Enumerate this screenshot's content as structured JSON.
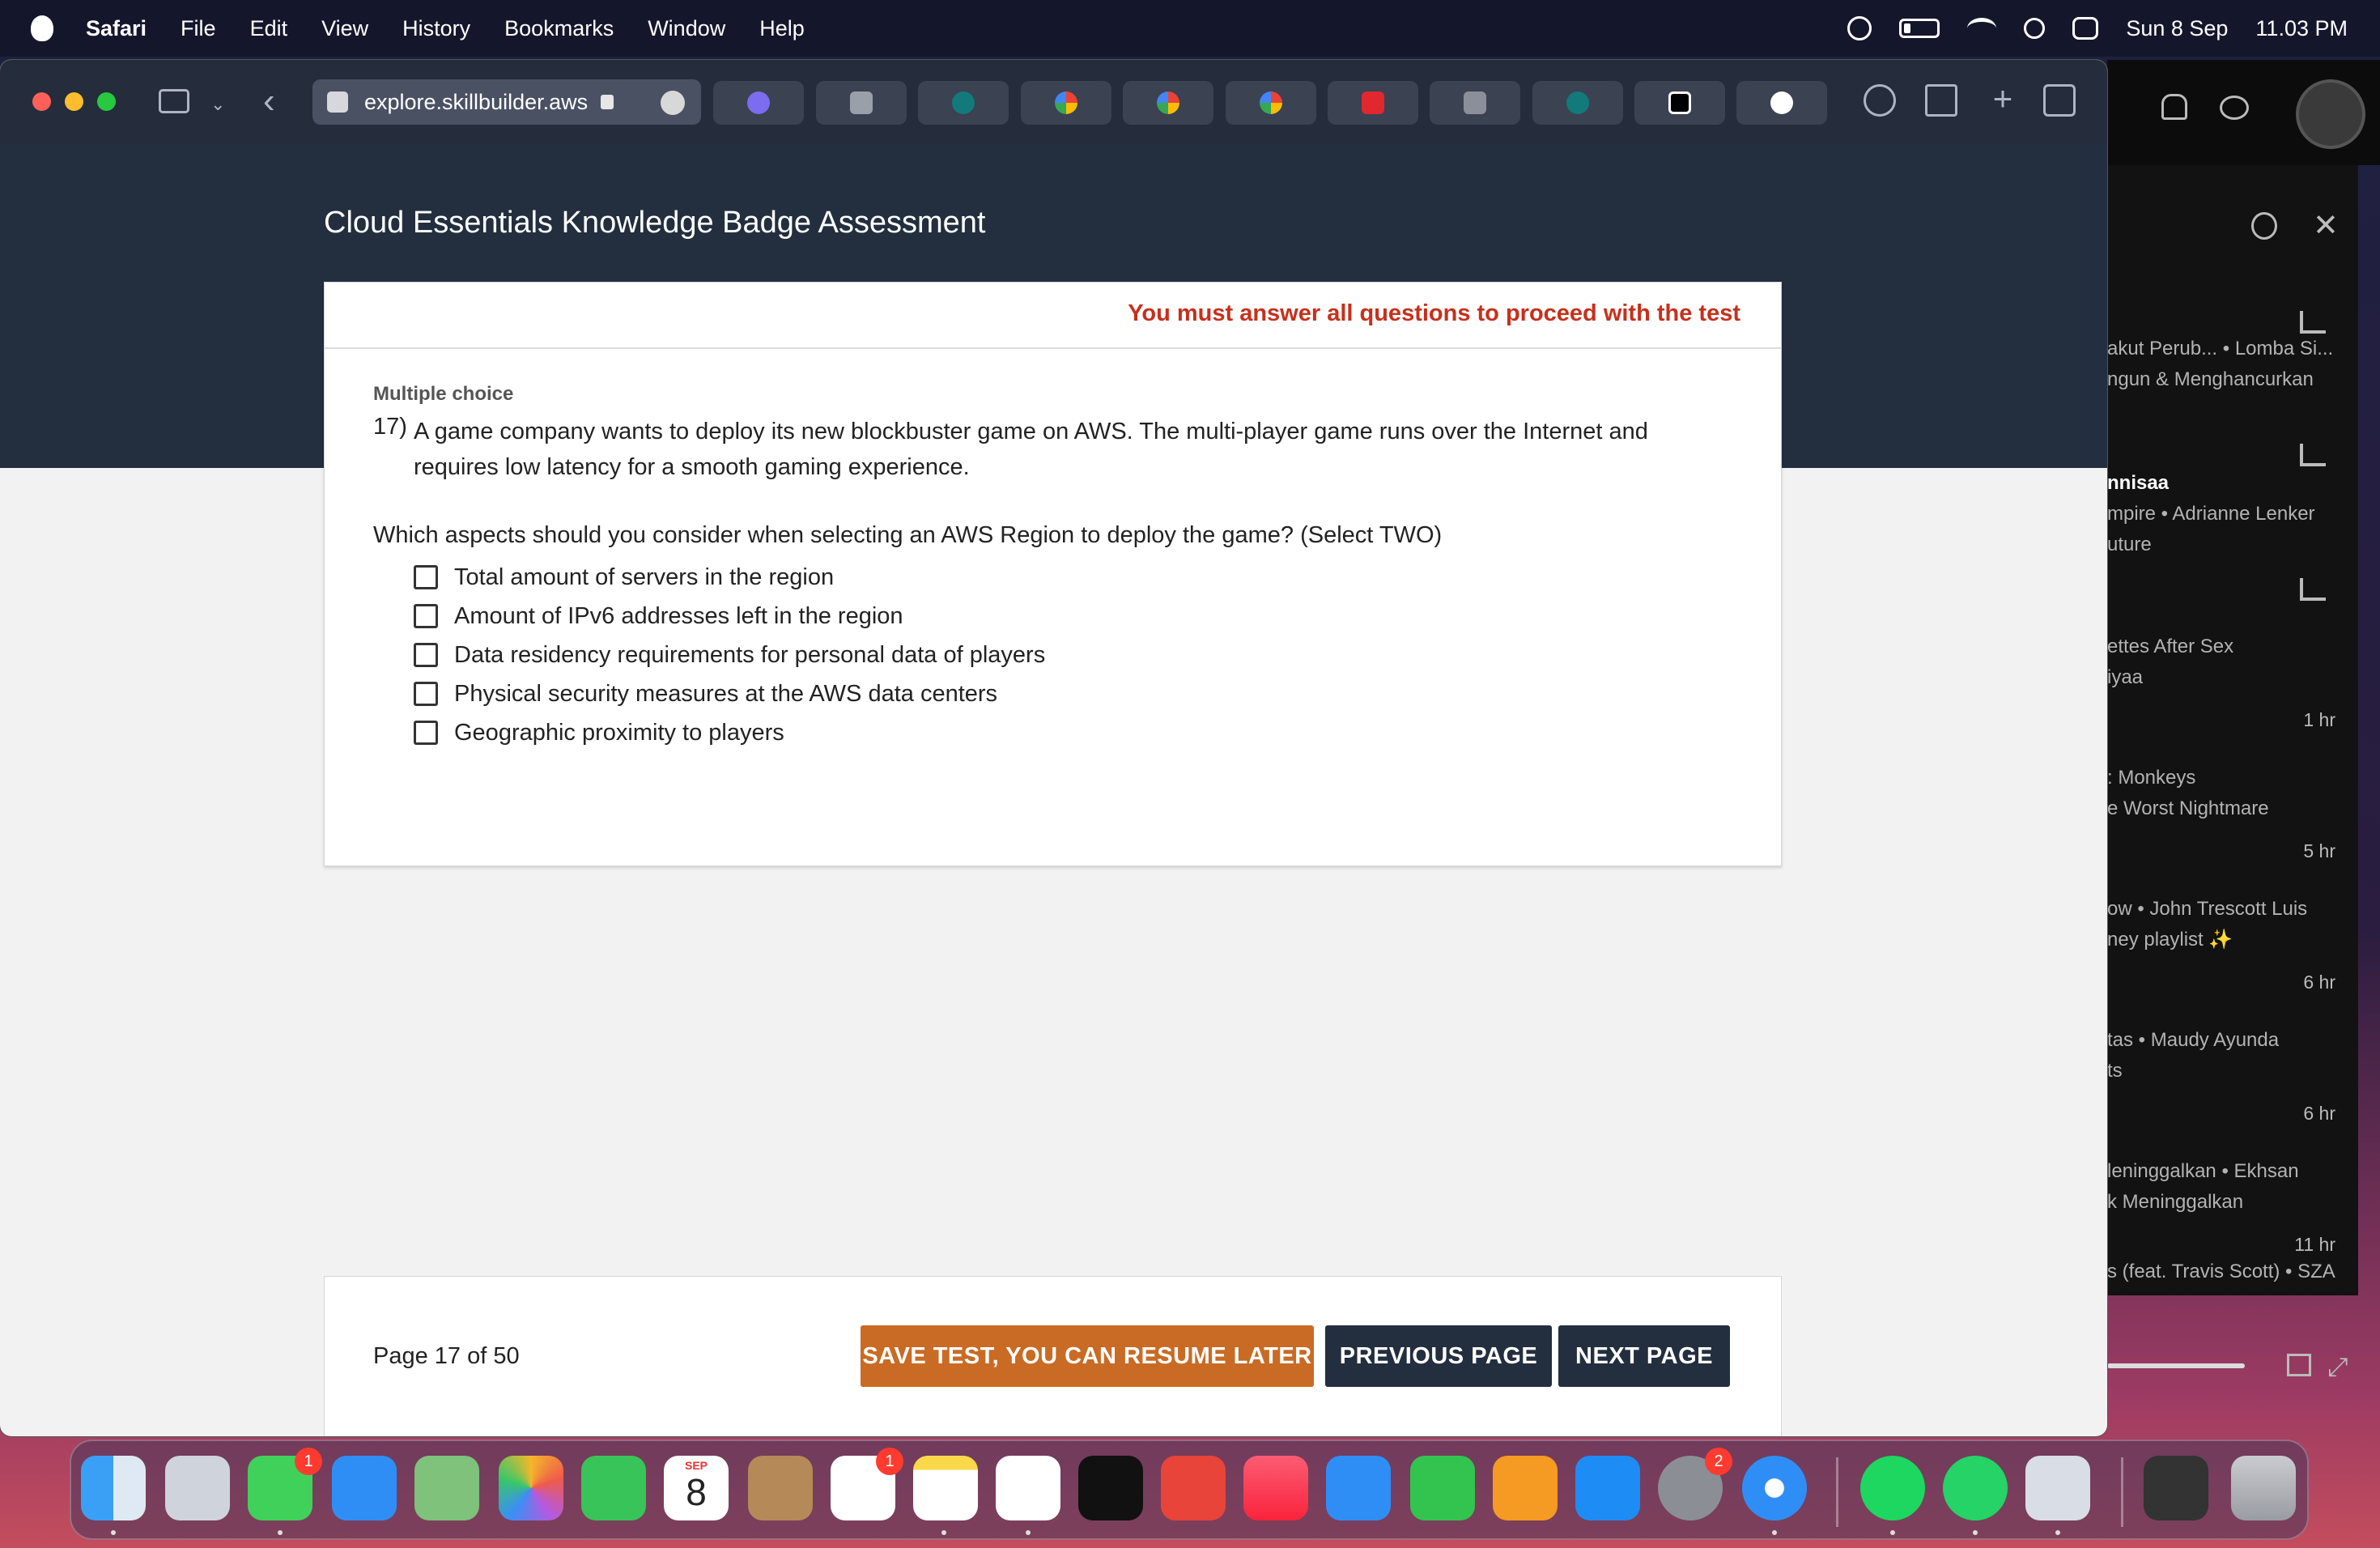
{
  "menubar": {
    "app": "Safari",
    "items": [
      "File",
      "Edit",
      "View",
      "History",
      "Bookmarks",
      "Window",
      "Help"
    ],
    "date": "Sun 8 Sep",
    "time": "11.03 PM"
  },
  "browser": {
    "url": "explore.skillbuilder.aws"
  },
  "page": {
    "title": "Cloud Essentials Knowledge Badge Assessment",
    "warning": "You must answer all questions to proceed with the test",
    "question_type": "Multiple choice",
    "question_number": "17)",
    "question_text": "A game company wants to deploy its new blockbuster game on AWS. The multi-player game runs over the Internet and requires low latency for a smooth gaming experience.",
    "prompt": "Which aspects should you consider when selecting an AWS Region to deploy the game? (Select TWO)",
    "options": [
      "Total amount of servers in the region",
      "Amount of IPv6 addresses left in the region",
      "Data residency requirements for personal data of players",
      "Physical security measures at the AWS data centers",
      "Geographic proximity to players"
    ]
  },
  "footer": {
    "page_info": "Page 17 of 50",
    "save_label": "SAVE TEST, YOU CAN RESUME LATER",
    "prev_label": "PREVIOUS PAGE",
    "next_label": "NEXT PAGE"
  },
  "spotify": {
    "rows": [
      {
        "line1": "akut Perub...  • Lomba Si...",
        "line2": "ngun & Menghancurkan",
        "time": ""
      },
      {
        "title": "nnisaa",
        "line1": "mpire • Adrianne Lenker",
        "line2": "uture",
        "time": ""
      },
      {
        "line1": "ettes After Sex",
        "line2": "iyaa",
        "time": ""
      },
      {
        "line1": ": Monkeys",
        "line2": "e Worst Nightmare",
        "time": "1 hr"
      },
      {
        "line1": "ow • John Trescott Luis",
        "line2": "ney playlist ✨",
        "time": "5 hr"
      },
      {
        "line1": "tas • Maudy Ayunda",
        "line2": "ts",
        "time": "6 hr"
      },
      {
        "line1": "leninggalkan • Ekhsan",
        "line2": "k Meninggalkan",
        "time": "6 hr"
      },
      {
        "line1": "s (feat. Travis Scott) • SZA",
        "line2": "",
        "time": "11 hr"
      }
    ]
  },
  "dock": {
    "calendar_month": "SEP",
    "calendar_day": "8",
    "badges": {
      "messages": "1",
      "reminders": "1",
      "settings": "2"
    }
  }
}
